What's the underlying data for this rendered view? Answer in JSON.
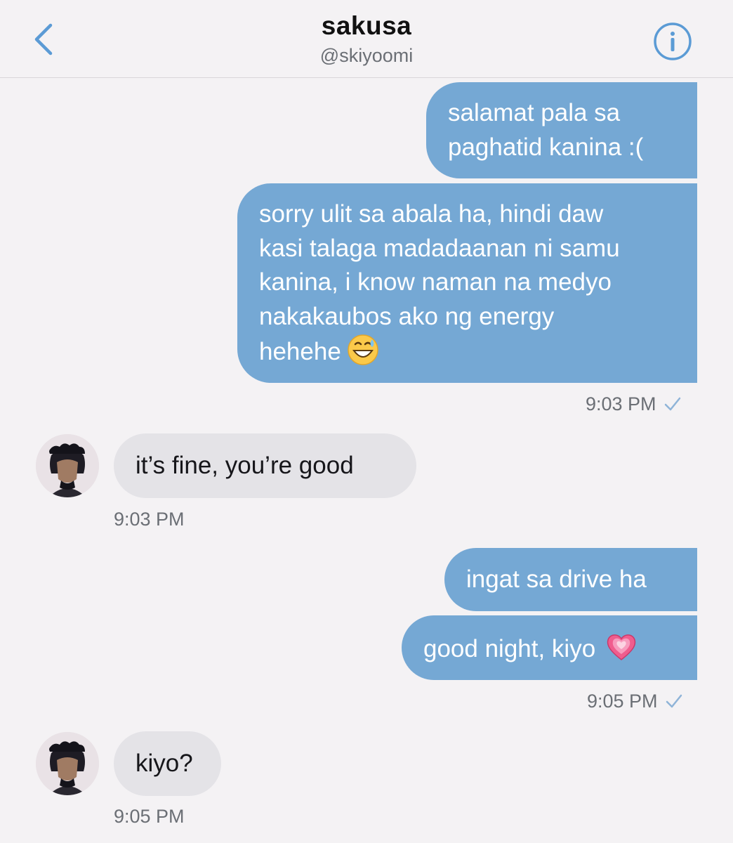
{
  "header": {
    "title": "sakusa",
    "handle": "@skiyoomi",
    "back_icon": "chevron-left-icon",
    "info_icon": "info-icon",
    "accent_color": "#5b9bd5"
  },
  "messages": [
    {
      "id": "m1",
      "direction": "sent",
      "lines": [
        "salamat pala sa",
        "paghatid kanina :("
      ]
    },
    {
      "id": "m2",
      "direction": "sent",
      "lines": [
        "sorry ulit sa abala ha, hindi daw",
        "kasi talaga madadaanan ni samu",
        "kanina, i know naman na medyo",
        "nakakaubos ako ng energy",
        "hehehe"
      ],
      "emoji": "grinning-sweat-emoji",
      "time": "9:03 PM"
    },
    {
      "id": "m3",
      "direction": "received",
      "text": "it’s fine, you’re good",
      "time": "9:03 PM"
    },
    {
      "id": "m4",
      "direction": "sent",
      "text": "ingat sa drive ha"
    },
    {
      "id": "m5",
      "direction": "sent",
      "text": "good night, kiyo",
      "emoji": "growing-heart-emoji",
      "time": "9:05 PM"
    },
    {
      "id": "m6",
      "direction": "received",
      "text": "kiyo?",
      "time": "9:05 PM"
    }
  ],
  "colors": {
    "sent_bubble": "#75a8d4",
    "received_bubble": "#e4e3e7",
    "background": "#f4f2f4",
    "timestamp": "#6b6f75"
  }
}
